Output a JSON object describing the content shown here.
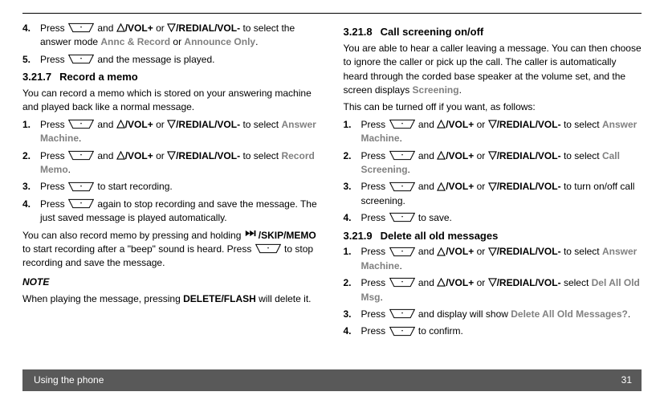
{
  "footer": {
    "label": "Using the phone",
    "page": "31"
  },
  "labels": {
    "vol_plus": "/VOL+",
    "vol_minus": "/REDIAL/VOL-",
    "or": " or ",
    "and": " and "
  },
  "col1": {
    "step4a": "Press ",
    "step4b": " to select the answer mode ",
    "step4c": " or ",
    "annc_record": "Annc & Record",
    "announce_only": "Announce Only",
    "step5a": "Press ",
    "step5b": " and the message is played.",
    "h317_num": "3.21.7",
    "h317_title": "Record a memo",
    "p317": "You can record a memo which is stored on your answering machine and played back like a normal message.",
    "s1a": "Press ",
    "s1b": " to select ",
    "answer_machine": "Answer Machine",
    "s2a": "Press ",
    "s2b": " to select ",
    "record_memo": "Record Memo",
    "s3a": "Press ",
    "s3b": " to start recording.",
    "s4a": "Press ",
    "s4b": " again to stop recording and save the message. The just saved message is played automatically.",
    "p_also_a": "You can also record memo by pressing and holding ",
    "skip_memo_label": "/SKIP/MEMO",
    "p_also_b": " to start recording after a \"beep\" sound is heard. Press ",
    "p_also_c": " to stop recording and save the message.",
    "note_label": "NOTE",
    "note_a": "When playing the message, pressing ",
    "delete_flash": "DELETE/FLASH",
    "note_b": " will delete it."
  },
  "col2": {
    "h318_num": "3.21.8",
    "h318_title": "Call screening on/off",
    "p318": "You are able to hear a caller leaving a message. You can then choose to ignore the caller or pick up the call. The caller is automatically heard through the corded base speaker at the volume set, and the screen displays ",
    "screening": "Screening",
    "p318b": "This can be turned off if you want, as follows:",
    "s1a": "Press ",
    "s1b": " to select ",
    "answer_machine": "Answer Machine",
    "s2a": "Press ",
    "s2b": " to select ",
    "call_screening": "Call Screening",
    "s3a": "Press ",
    "s3b": " to turn on/off call screening.",
    "s4a": "Press ",
    "s4b": " to save.",
    "h319_num": "3.21.9",
    "h319_title": "Delete all old messages",
    "d1a": "Press ",
    "d1b": " to select ",
    "d2a": "Press ",
    "d2b": " select ",
    "del_all_old_msg": "Del All Old Msg",
    "d3a": "Press ",
    "d3b": " and display will show ",
    "delete_all_old_messages": "Delete All Old Messages?",
    "d4a": "Press ",
    "d4b": " to confirm."
  },
  "numbers": {
    "n1": "1.",
    "n2": "2.",
    "n3": "3.",
    "n4": "4.",
    "n5": "5."
  }
}
